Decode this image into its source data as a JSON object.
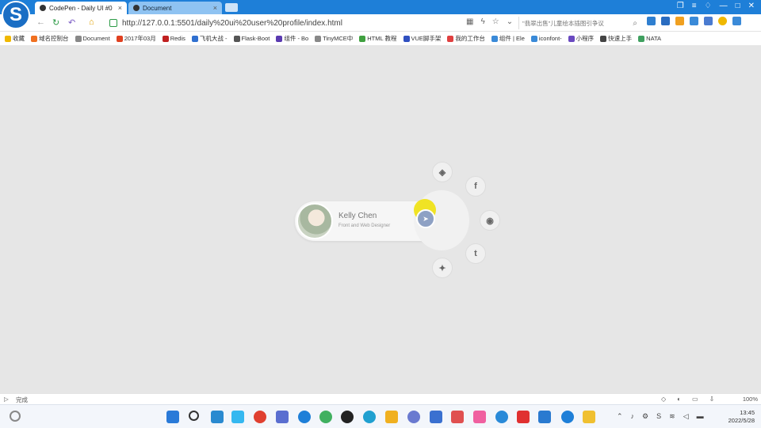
{
  "browser": {
    "tabs": [
      {
        "label": "CodePen - Daily UI #0",
        "close": "×"
      },
      {
        "label": "Document",
        "close": "×"
      }
    ],
    "url": "http://127.0.0.1:5501/daily%20ui%20user%20profile/index.html",
    "search_placeholder": "\"翡翠出售\"儿童绘本插图引争议",
    "status_text": "完成",
    "zoom": "100%",
    "bookmarks": [
      "收藏",
      "域名控制台",
      "Document",
      "2017年03月",
      "Redis",
      "飞机大战 -",
      "Flask-Boot",
      "组件 - Bo",
      "TinyMCE中",
      "HTML 教程",
      "VUE脚手架",
      "我的工作台",
      "组件 | Ele",
      "iconfont-",
      "小程序",
      "快速上手",
      "NATA"
    ]
  },
  "profile": {
    "name": "Kelly Chen",
    "role": "Front and Web Designer"
  },
  "social": [
    {
      "name": "codepen",
      "glyph": "◈"
    },
    {
      "name": "facebook",
      "glyph": "f"
    },
    {
      "name": "github",
      "glyph": "◉"
    },
    {
      "name": "tumblr",
      "glyph": "t"
    },
    {
      "name": "twitter",
      "glyph": "✦"
    }
  ],
  "clock": {
    "time": "13:45",
    "date": "2022/5/28"
  },
  "colors": {
    "accent": "#1e7fd8",
    "cursor": "#f0e100",
    "hub": "#8ea1c4"
  }
}
